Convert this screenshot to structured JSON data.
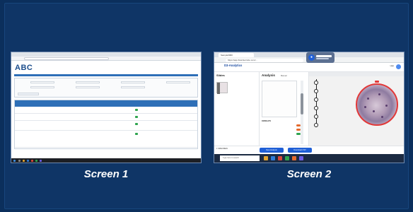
{
  "screens": [
    {
      "caption": "Screen 1",
      "app": {
        "logo": "ABC",
        "logo_sub": "",
        "url": "",
        "nav": [
          "",
          "",
          "",
          "",
          "",
          "",
          "",
          "",
          ""
        ],
        "user_lines": [
          "",
          ""
        ]
      }
    },
    {
      "caption": "Screen 2",
      "app": {
        "browser_tab": "Sample0000",
        "url": "https://app.flowinterrobo.com/...",
        "name": "D3-Analytics",
        "menu": [
          "",
          "",
          "",
          "",
          "",
          "",
          ""
        ],
        "help": "Help",
        "slides_title": "Slides",
        "analysis_title": "Analysis",
        "analysis_mode": "Manual",
        "overlays_title": "OVERLAYS",
        "viewer_title": "",
        "scale_text": "",
        "specimen_text": "1 SPECIMEN",
        "new_analysis_label": "New Analysis",
        "download_label": "Download CSV",
        "taskbar_search": "Type here to search",
        "colors": {
          "primary": "#1f5fd6",
          "accent": "#e23838",
          "toggle": "#e46a2e"
        }
      }
    }
  ],
  "background_color": "#0b2f5c"
}
